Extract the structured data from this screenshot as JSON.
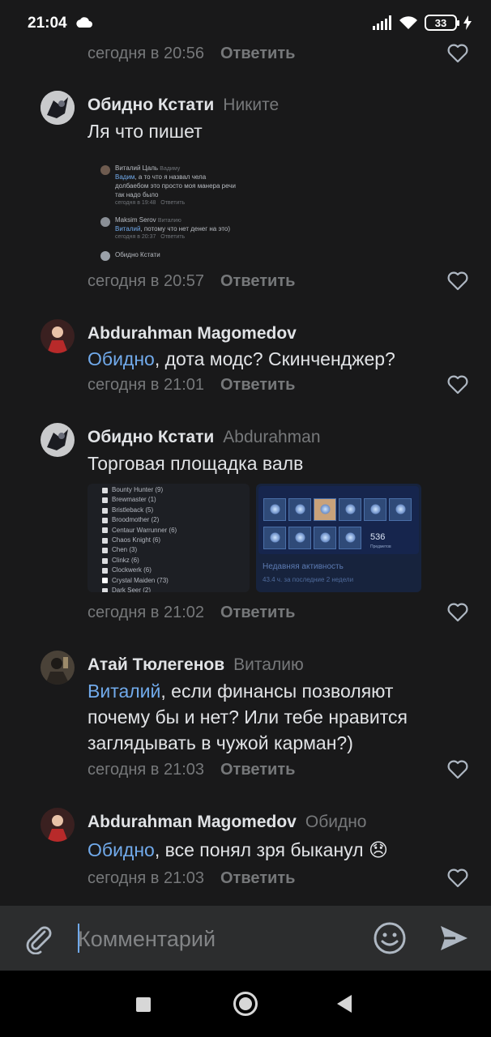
{
  "status_bar": {
    "time": "21:04",
    "battery": "33",
    "icons": [
      "cloud-icon",
      "signal-icon",
      "wifi-icon",
      "battery-icon",
      "charging-icon"
    ]
  },
  "colors": {
    "background": "#19191a",
    "text": "#e1e3e6",
    "muted": "#76787a",
    "mention": "#71aaeb",
    "composer": "#2c2d2e"
  },
  "reply_label": "Ответить",
  "top_comment": {
    "date": "сегодня в 20:56"
  },
  "comments": [
    {
      "author": "Обидно Кстати",
      "reply_to": "Никите",
      "text": "Ля что пишет",
      "date": "сегодня в 20:57",
      "attachment": {
        "row1_name": "Виталий Цаль",
        "row1_to": "Вадиму",
        "row1_mention": "Вадим",
        "row1_text_a": ", а то что я назвал чела",
        "row1_text_b": "долбаебом это просто моя манера речи",
        "row1_text_c": "так надо было",
        "row1_date": "сегодня в 19:48",
        "row1_reply": "Ответить",
        "row2_name": "Maksim Serov",
        "row2_to": "Виталию",
        "row2_mention": "Виталий",
        "row2_text": ", потому что нет денег на это)",
        "row2_date": "сегодня в 20:37",
        "row2_reply": "Ответить",
        "row3_name": "Обидно Кстати"
      }
    },
    {
      "author": "Abdurahman Magomedov",
      "reply_to": "",
      "mention": "Обидно",
      "text": ", дота модс? Скинченджер?",
      "date": "сегодня в 21:01"
    },
    {
      "author": "Обидно Кстати",
      "reply_to": "Abdurahman",
      "text": "Торговая площадка валв",
      "date": "сегодня в 21:02",
      "heroes": [
        "Bounty Hunter (9)",
        "Brewmaster (1)",
        "Bristleback (5)",
        "Broodmother (2)",
        "Centaur Warrunner (6)",
        "Chaos Knight (6)",
        "Chen (3)",
        "Clinkz (6)",
        "Clockwerk (6)",
        "Crystal Maiden (73)",
        "Dark Seer (2)"
      ],
      "steam": {
        "count": "536",
        "count_label": "Предметов",
        "activity_title": "Недавняя активность",
        "activity_hours": "43.4 ч. за последние 2 недели"
      }
    },
    {
      "author": "Атай Тюлегенов",
      "reply_to": "Виталию",
      "mention": "Виталий",
      "text_line1": ", если финансы позволяют",
      "text_line2": "почему бы и нет? Или тебе нравится",
      "text_line3": "заглядывать в чужой карман?)",
      "date": "сегодня в 21:03"
    },
    {
      "author": "Abdurahman Magomedov",
      "reply_to": "Обидно",
      "mention": "Обидно",
      "text": ", все понял зря быканул",
      "emoji": "😞",
      "date": "сегодня в 21:03"
    }
  ],
  "composer": {
    "placeholder": "Комментарий"
  }
}
